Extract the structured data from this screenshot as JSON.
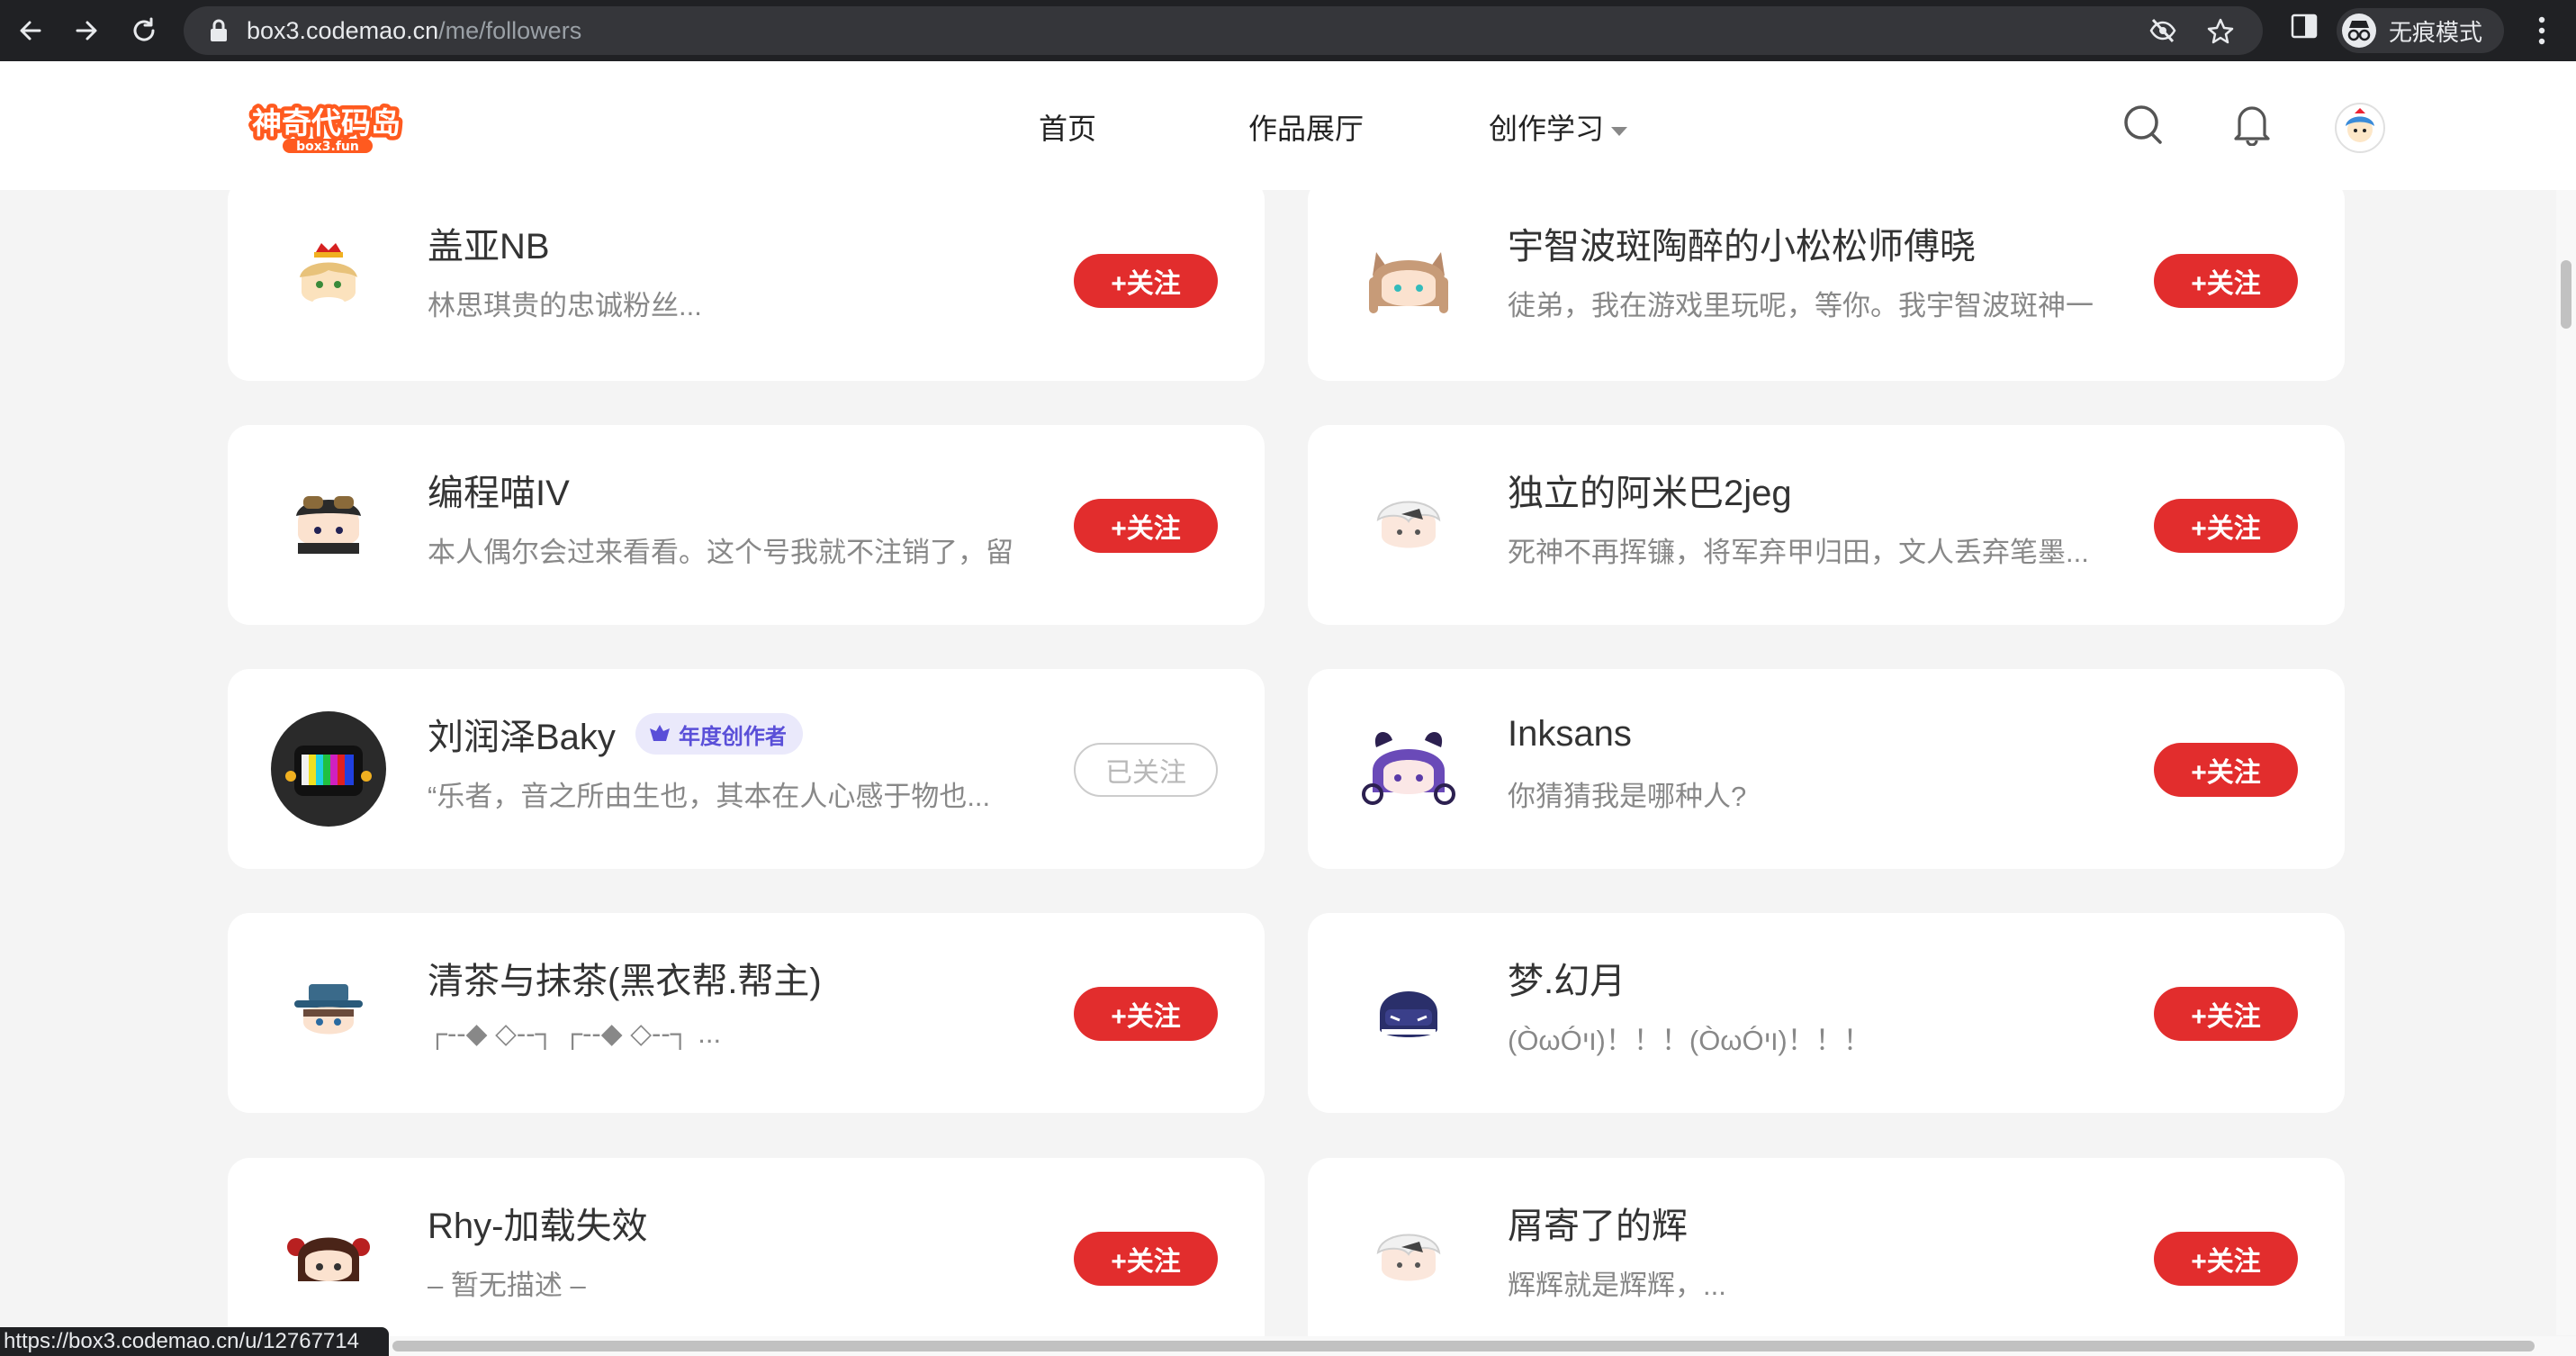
{
  "browser": {
    "url_host": "box3.codemao.cn",
    "url_path": "/me/followers",
    "incognito_label": "无痕模式",
    "status_link": "https://box3.codemao.cn/u/12767714"
  },
  "header": {
    "logo_text": "神奇代码岛",
    "logo_sub": "box3.fun",
    "nav": [
      {
        "label": "首页"
      },
      {
        "label": "作品展厅"
      },
      {
        "label": "创作学习"
      }
    ]
  },
  "colors": {
    "follow_red": "#e22d2d",
    "badge_purple": "#5a4fd8",
    "page_bg": "#f4f4f4"
  },
  "users": [
    {
      "name": "盖亚NB",
      "desc": "林思琪贵的忠诚粉丝...",
      "button": "+关注",
      "followed": false,
      "avatar": "crown-avatar"
    },
    {
      "name": "宇智波斑陶醉的小松松师傅晓",
      "desc": "徒弟，我在游戏里玩呢，等你。我宇智波斑神一",
      "button": "+关注",
      "followed": false,
      "avatar": "cat-ear-avatar"
    },
    {
      "name": "编程喵IV",
      "desc": "本人偶尔会过来看看。这个号我就不注销了，留",
      "button": "+关注",
      "followed": false,
      "avatar": "goggles-avatar"
    },
    {
      "name": "独立的阿米巴2jeg",
      "desc": "死神不再挥镰，将军弃甲归田，文人丢弃笔墨...",
      "button": "+关注",
      "followed": false,
      "avatar": "white-hair-avatar"
    },
    {
      "name": "刘润泽Baky",
      "desc": "“乐者，音之所由生也，其本在人心感于物也...",
      "button": "已关注",
      "followed": true,
      "badge": "年度创作者",
      "avatar": "tv-head-avatar"
    },
    {
      "name": "Inksans",
      "desc": "你猜猜我是哪种人?",
      "button": "+关注",
      "followed": false,
      "avatar": "purple-horn-avatar"
    },
    {
      "name": "清茶与抹茶(黑衣帮.帮主)",
      "desc": "┌--◆ ◇--┐ ┌--◆ ◇--┐ ...",
      "button": "+关注",
      "followed": false,
      "avatar": "blue-hat-avatar"
    },
    {
      "name": "梦.幻月",
      "desc": "(ÒωÓױ)！！！(ÒωÓױ)！！！",
      "button": "+关注",
      "followed": false,
      "avatar": "navy-hood-avatar"
    },
    {
      "name": "Rhy-加载失效",
      "desc": "– 暂无描述 –",
      "button": "+关注",
      "followed": false,
      "avatar": "red-bow-avatar"
    },
    {
      "name": "屑寄了的辉",
      "desc": "辉辉就是辉辉，...",
      "button": "+关注",
      "followed": false,
      "avatar": "white-hair-avatar-2"
    }
  ]
}
